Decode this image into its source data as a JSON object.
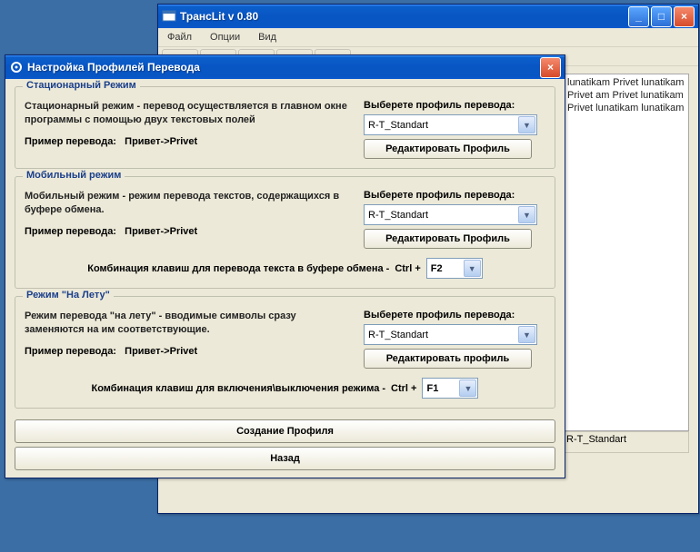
{
  "main_window": {
    "title": "ТрансLit v 0.80",
    "menu": {
      "file": "Файл",
      "options": "Опции",
      "view": "Вид"
    },
    "output_text": "lunatikam Privet lunatikam Privet am Privet lunatikam Privet lunatikam lunatikam",
    "status": "R-T_Standart"
  },
  "dialog": {
    "title": "Настройка Профилей Перевода",
    "stationary": {
      "heading": "Стационарный Режим",
      "desc": "Стационарный режим - перевод осуществляется в главном окне программы с помощью двух текстовых полей",
      "example_label": "Пример перевода:",
      "example_value": "Привет->Privet",
      "select_label": "Выберете профиль перевода:",
      "profile": "R-T_Standart",
      "edit_btn": "Редактировать Профиль"
    },
    "mobile": {
      "heading": "Мобильный режим",
      "desc": "Мобильный режим - режим перевода текстов, содержащихся в буфере обмена.",
      "example_label": "Пример перевода:",
      "example_value": "Привет->Privet",
      "select_label": "Выберете профиль перевода:",
      "profile": "R-T_Standart",
      "edit_btn": "Редактировать Профиль",
      "hotkey_label": "Комбинация клавиш для перевода текста в буфере обмена -",
      "hotkey_prefix": "Ctrl +",
      "hotkey_value": "F2"
    },
    "onthefly": {
      "heading": "Режим \"На Лету\"",
      "desc": "Режим перевода \"на лету\" - вводимые символы сразу заменяются на им соответствующие.",
      "example_label": "Пример перевода:",
      "example_value": "Привет->Privet",
      "select_label": "Выберете профиль перевода:",
      "profile": "R-T_Standart",
      "edit_btn": "Редактировать профиль",
      "hotkey_label": "Комбинация клавиш для включения\\выключения режима -",
      "hotkey_prefix": "Ctrl +",
      "hotkey_value": "F1"
    },
    "create_btn": "Создание Профиля",
    "back_btn": "Назад"
  }
}
